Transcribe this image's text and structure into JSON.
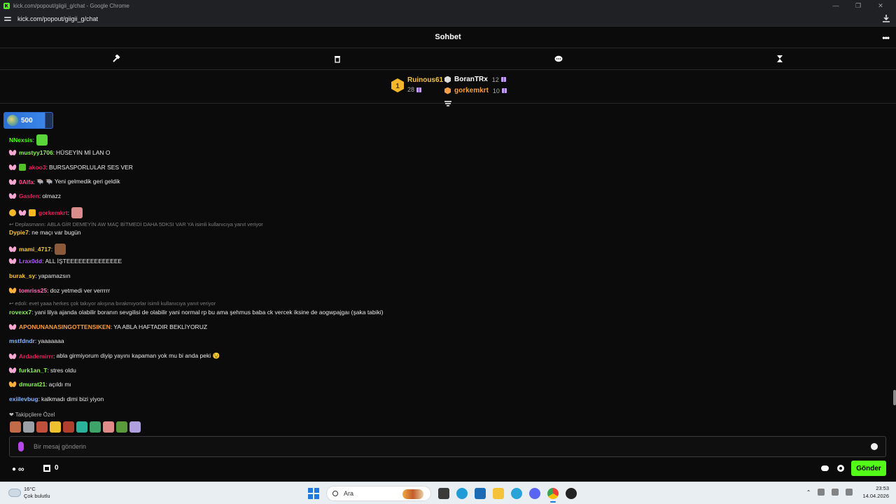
{
  "window": {
    "title": "kick.com/popout/giigii_g/chat - Google Chrome",
    "controls": [
      "—",
      "❐",
      "✕"
    ]
  },
  "address": {
    "url": "kick.com/popout/giigii_g/chat"
  },
  "chat": {
    "title": "Sohbet",
    "more": "•••"
  },
  "leaderboard": {
    "first": {
      "name": "Ruinous61",
      "count": "28",
      "rank": "1"
    },
    "others": [
      {
        "name": "BoranTRx",
        "count": "12",
        "color": "#ffffff"
      },
      {
        "name": "gorkemkrt",
        "count": "10",
        "color": "#f59e42"
      }
    ]
  },
  "subs": {
    "count": "500"
  },
  "messages": [
    {
      "user": "NNexsis",
      "color": "#53fc18",
      "text": "",
      "badges": [],
      "emote": "#5bd63a"
    },
    {
      "user": "mustyy1706",
      "color": "#8ef25a",
      "text": "HÜSEYİN Mİ LAN O",
      "badges": [
        "butterfly"
      ]
    },
    {
      "user": "akoo3",
      "color": "#e0245e",
      "text": "BURSASPORLULAR SES VER",
      "badges": [
        "butterfly",
        "sub-green"
      ]
    },
    {
      "user": "0Alfa",
      "color": "#ff4d8d",
      "text": "🐃 🐃 Yeni gelmedik geri geldik",
      "badges": [
        "butterfly"
      ]
    },
    {
      "user": "Gasfen",
      "color": "#e0245e",
      "text": "olmazz",
      "badges": [
        "butterfly"
      ]
    },
    {
      "user": "gorkemkrt",
      "color": "#e0245e",
      "text": "",
      "badges": [
        "gifter-1",
        "butterfly",
        "gift"
      ],
      "emote": "#d98c8c"
    },
    {
      "reply": "Deplasmann: ABLA GİR DEMEYİN AW MAÇ BİTMEDİ DAHA 5DKSI VAR YA isimli kullanıcıya yanıt veriyor"
    },
    {
      "user": "Dypie7",
      "color": "#f5c542",
      "text": "ne maçı var bugün",
      "badges": []
    },
    {
      "user": "mami_4717",
      "color": "#f5c542",
      "text": "",
      "badges": [
        "butterfly"
      ],
      "emote": "#8a5a3a"
    },
    {
      "user": "Lrax0dd",
      "color": "#b15cff",
      "text": "ALL İŞTEEEEEEEEEEEEEE",
      "badges": [
        "butterfly"
      ]
    },
    {
      "user": "burak_sy",
      "color": "#f5c542",
      "text": "yapamazsın",
      "badges": []
    },
    {
      "user": "tomriss25",
      "color": "#ff6fb5",
      "text": "doz yetmedi ver verrrrr",
      "badges": [
        "butterfly-orange"
      ]
    },
    {
      "reply": "edoli: evet yaaa herkes çok takıyor akışına bırakmıyorlar isimli kullanıcıya yanıt veriyor"
    },
    {
      "user": "rovexx7",
      "color": "#8ef25a",
      "text": "yani lilya ajanda olabilir boranın sevgilisi de olabilir yani normal rp bu ama şehmus baba ck vercek iksine de aogwpajgaı (şaka tabiki)",
      "badges": []
    },
    {
      "user": "APONUNANASINGOTTENSIKEN",
      "color": "#f59e42",
      "text": "YA ABLA HAFTADIR BEKLİYORUZ",
      "badges": [
        "butterfly"
      ]
    },
    {
      "user": "mstfdndr",
      "color": "#8ab4ff",
      "text": "yaaaaaaa",
      "badges": []
    },
    {
      "user": "Ardademirrr",
      "color": "#e0245e",
      "text": "abla girmiyorum diyip yayını kapaman yok mu bi anda peki 😉",
      "badges": [
        "butterfly"
      ]
    },
    {
      "user": "furk1an_T",
      "color": "#8ef25a",
      "text": "stres oldu",
      "badges": [
        "butterfly"
      ]
    },
    {
      "user": "dmurat21",
      "color": "#8ef25a",
      "text": "açıldı mı",
      "badges": [
        "butterfly-orange"
      ]
    },
    {
      "user": "exiilevbug",
      "color": "#8ab4ff",
      "text": "kalkmadı dimi bizi yiyon",
      "badges": []
    }
  ],
  "followers_label": "Takipçilere Özel",
  "follower_emotes": [
    "#c26a4a",
    "#9aa0a6",
    "#c0503c",
    "#f0c030",
    "#b0402c",
    "#2ab39a",
    "#3fa46a",
    "#e08a8a",
    "#5a9a3a",
    "#b0a0e0"
  ],
  "input": {
    "placeholder": "Bir mesaj gönderin"
  },
  "bottom": {
    "infinity": "∞",
    "store_count": "0",
    "send_label": "Gönder"
  },
  "taskbar": {
    "temp": "16°C",
    "weather": "Çok bulutlu",
    "search": "Ara",
    "time": "23:53",
    "date": "14.04.2026"
  }
}
